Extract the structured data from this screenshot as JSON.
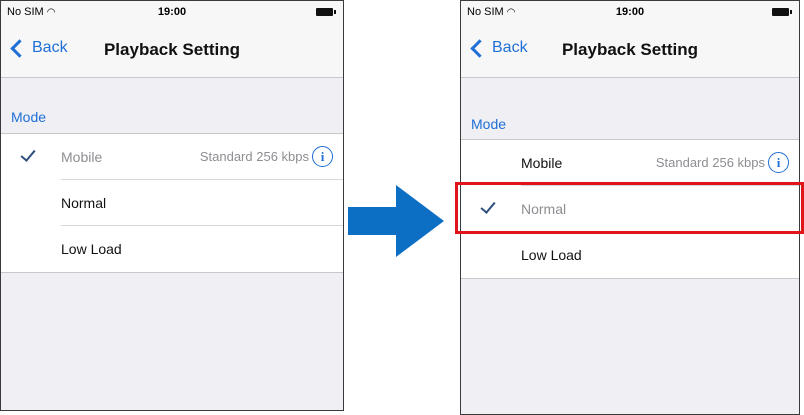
{
  "status_bar": {
    "carrier": "No SIM",
    "wifi_icon": "wifi-icon",
    "time": "19:00",
    "battery_icon": "battery-icon"
  },
  "nav": {
    "back_label": "Back",
    "title": "Playback Setting"
  },
  "section": {
    "header": "Mode"
  },
  "rows": {
    "mobile": {
      "label": "Mobile",
      "detail": "Standard 256 kbps",
      "info": "i"
    },
    "normal": {
      "label": "Normal"
    },
    "low_load": {
      "label": "Low Load"
    }
  },
  "left_screen": {
    "selected": "Mobile"
  },
  "right_screen": {
    "selected": "Normal"
  },
  "colors": {
    "accent": "#1f6fd6",
    "arrow": "#0d6fc4",
    "highlight": "#e0151b",
    "background": "#efeff4"
  }
}
